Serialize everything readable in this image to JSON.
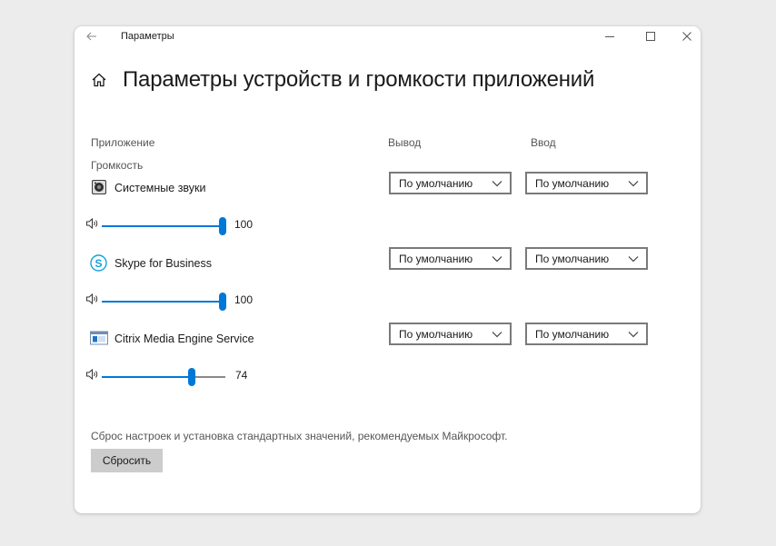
{
  "titlebar": {
    "title": "Параметры"
  },
  "page": {
    "title": "Параметры устройств и громкости приложений"
  },
  "columns": {
    "app": "Приложение",
    "volume": "Громкость",
    "output": "Вывод",
    "input": "Ввод"
  },
  "apps": [
    {
      "name": "Системные звуки",
      "icon": "system-sounds-icon",
      "volume": 100,
      "volume_label": "100",
      "output": "По умолчанию",
      "input": "По умолчанию"
    },
    {
      "name": "Skype for Business",
      "icon": "skype-icon",
      "volume": 100,
      "volume_label": "100",
      "output": "По умолчанию",
      "input": "По умолчанию"
    },
    {
      "name": "Citrix Media Engine Service",
      "icon": "citrix-icon",
      "volume": 74,
      "volume_label": "74",
      "output": "По умолчанию",
      "input": "По умолчанию"
    }
  ],
  "reset": {
    "description": "Сброс настроек и установка стандартных значений, рекомендуемых Майкрософт.",
    "button_label": "Сбросить"
  },
  "colors": {
    "accent": "#0078d7",
    "window_bg": "#ffffff",
    "page_bg": "#ececec",
    "button_bg": "#cccccc"
  }
}
